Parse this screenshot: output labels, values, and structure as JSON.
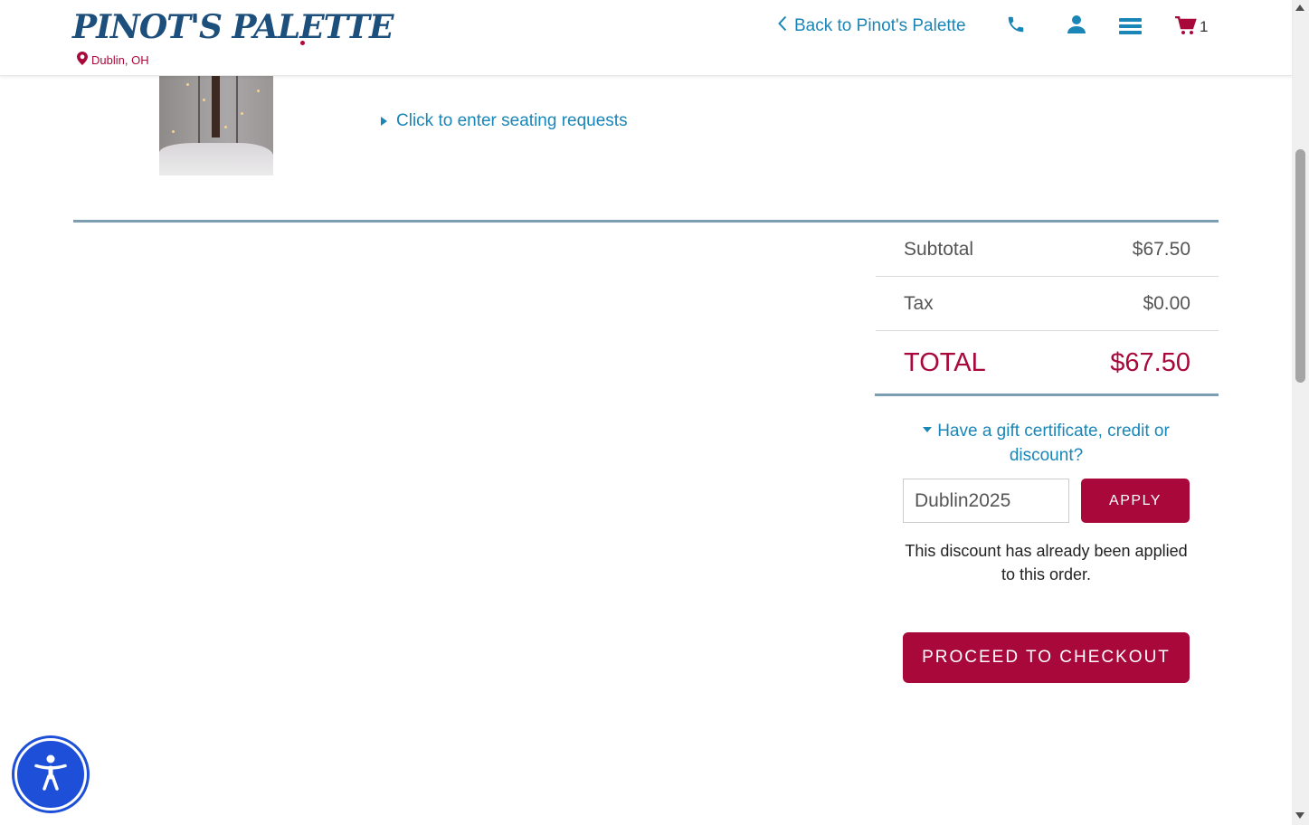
{
  "header": {
    "logo_text": "PINOT'S PALETTE",
    "location": "Dublin, OH",
    "back_link": "Back to Pinot's Palette",
    "cart_count": "1",
    "icons": [
      "map-pin-icon",
      "chevron-left-icon",
      "phone-icon",
      "user-icon",
      "menu-icon",
      "cart-icon"
    ]
  },
  "order_item": {
    "thumbnail_alt": "painting thumbnail",
    "seating_link": "Click to enter seating requests"
  },
  "totals": {
    "subtotal_label": "Subtotal",
    "subtotal_value": "$67.50",
    "tax_label": "Tax",
    "tax_value": "$0.00",
    "total_label": "TOTAL",
    "total_value": "$67.50"
  },
  "discount": {
    "toggle_label": "Have a gift certificate, credit or discount?",
    "code_value": "Dublin2025",
    "apply_label": "APPLY",
    "notice": "This discount has already been applied to this order."
  },
  "checkout": {
    "button_label": "PROCEED TO CHECKOUT"
  },
  "colors": {
    "brand_blue": "#1d4f7c",
    "link_blue": "#1a86b8",
    "accent_red": "#a8093a",
    "divider": "#7d9db3"
  }
}
